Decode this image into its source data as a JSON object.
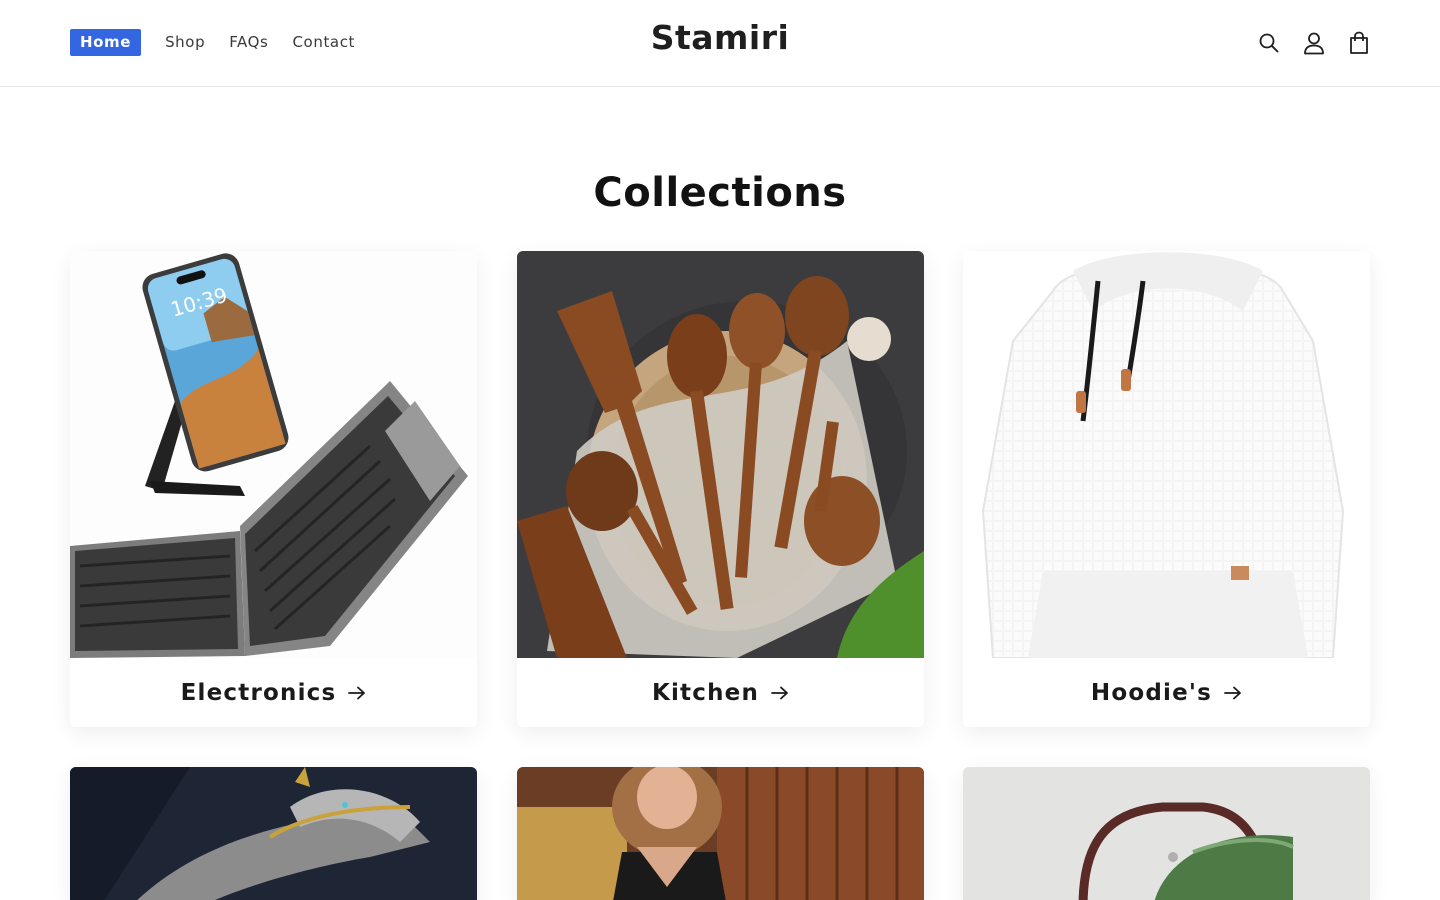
{
  "header": {
    "nav": [
      {
        "label": "Home",
        "active": true
      },
      {
        "label": "Shop",
        "active": false
      },
      {
        "label": "FAQs",
        "active": false
      },
      {
        "label": "Contact",
        "active": false
      }
    ],
    "logo": "Stamiri",
    "icons": [
      "search-icon",
      "account-icon",
      "cart-icon"
    ]
  },
  "page": {
    "title": "Collections"
  },
  "collections": [
    {
      "label": "Electronics",
      "image": "folding-keyboard-and-phone-stand"
    },
    {
      "label": "Kitchen",
      "image": "wooden-cooking-utensils"
    },
    {
      "label": "Hoodie's",
      "image": "white-waffle-hoodie"
    },
    {
      "label": "",
      "image": "dragon-bracelet"
    },
    {
      "label": "",
      "image": "satin-sleepwear"
    },
    {
      "label": "",
      "image": "green-leather-handbag"
    }
  ],
  "colors": {
    "accent": "#3366e0",
    "text": "#121212",
    "background": "#ffffff"
  }
}
